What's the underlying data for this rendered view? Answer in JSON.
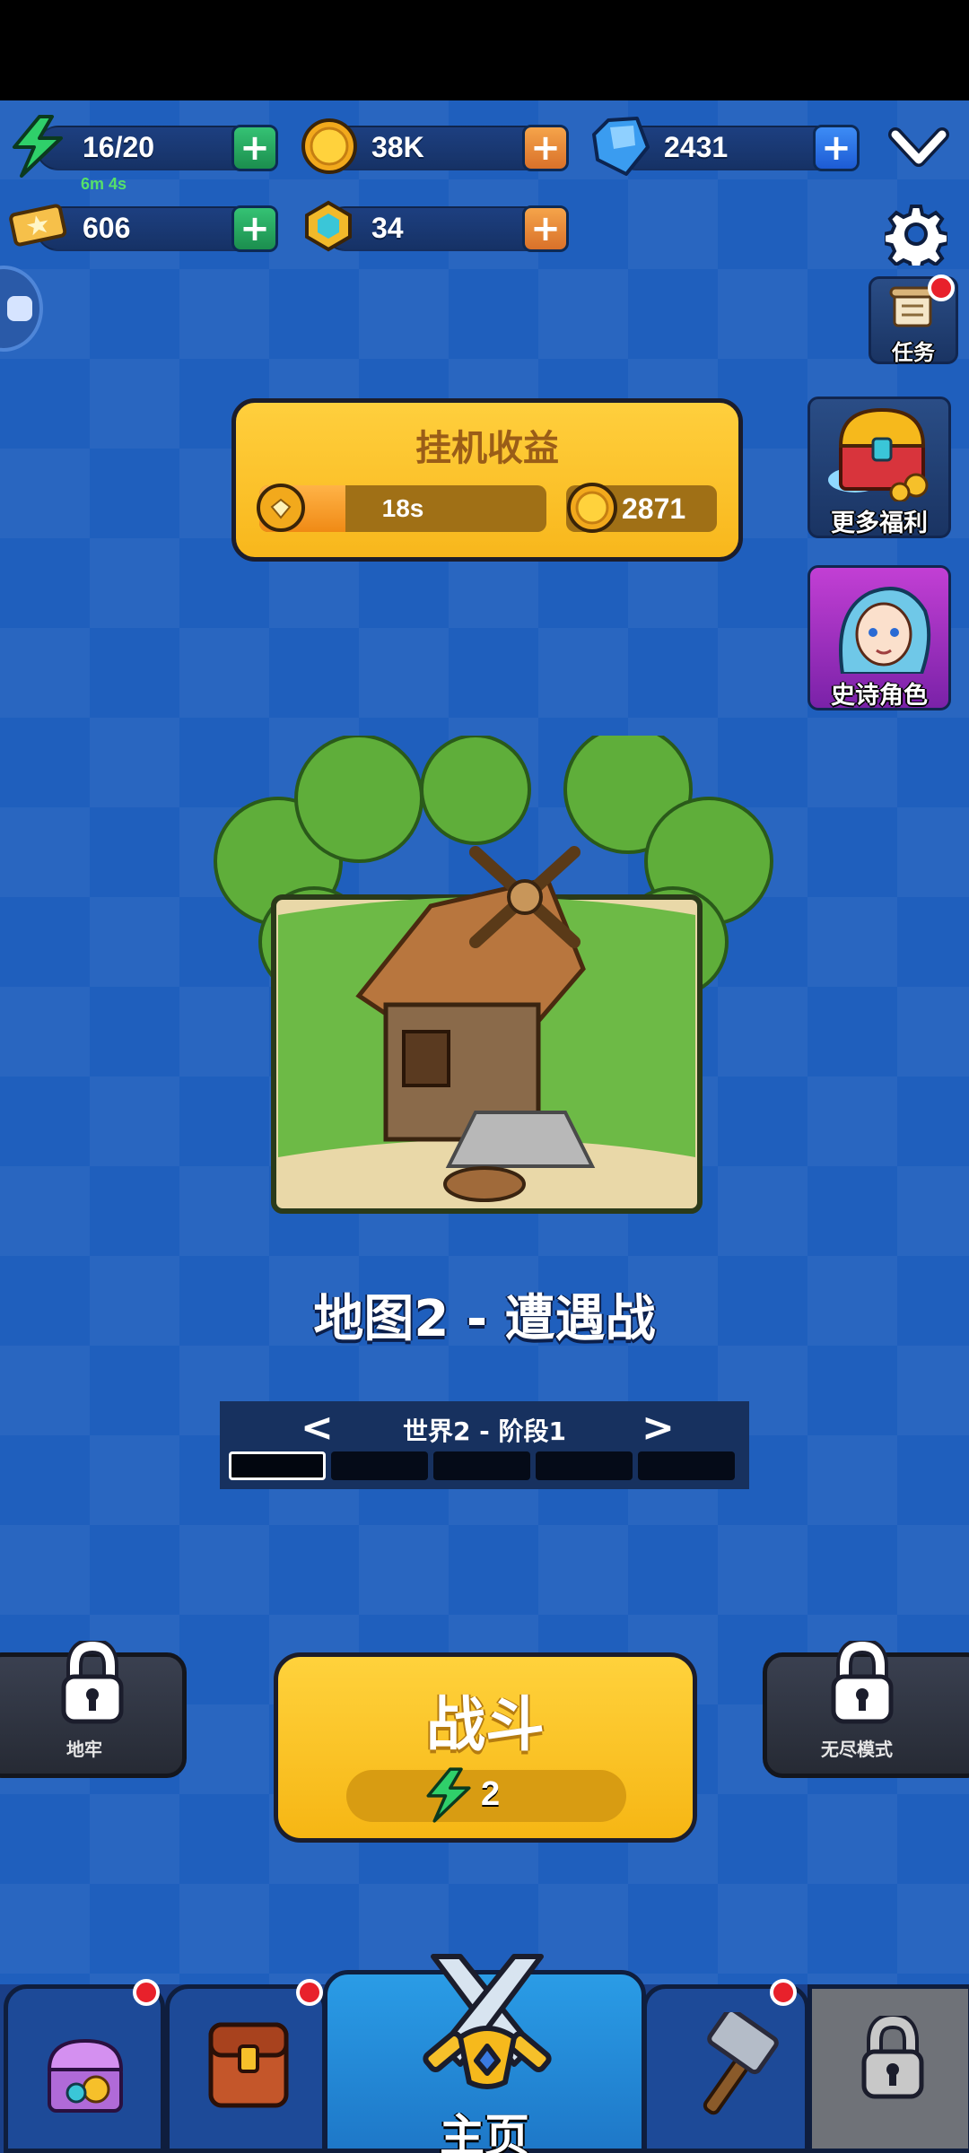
{
  "resources": {
    "energy": {
      "value": "16/20",
      "timer": "6m 4s",
      "icon": "lightning-icon"
    },
    "coins": {
      "value": "38K",
      "icon": "coin-icon"
    },
    "gems": {
      "value": "2431",
      "icon": "gem-icon"
    },
    "tickets": {
      "value": "606",
      "icon": "ticket-icon"
    },
    "crystals": {
      "value": "34",
      "icon": "crystal-icon"
    },
    "plus_symbol": "+"
  },
  "side_buttons": {
    "tasks_label": "任务",
    "more_benefits_label": "更多福利",
    "epic_hero_label": "史诗角色"
  },
  "idle_panel": {
    "title": "挂机收益",
    "timer": "18s",
    "progress_fraction": 0.3,
    "reward": "2871"
  },
  "map": {
    "title": "地图2 - 遭遇战",
    "stage_label": "世界2 - 阶段1",
    "prev_arrow": "<",
    "next_arrow": ">",
    "total_stages": 5,
    "current_stage": 1
  },
  "modes": {
    "dungeon_label": "地牢",
    "endless_label": "无尽模式"
  },
  "fight": {
    "label": "战斗",
    "energy_cost": "2"
  },
  "nav": {
    "home_label": "主页"
  },
  "colors": {
    "background": "#1f5fbd",
    "accent_yellow": "#f8b71c",
    "alert_red": "#e8212b"
  }
}
